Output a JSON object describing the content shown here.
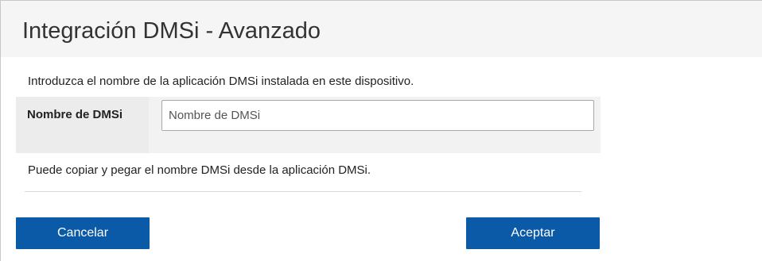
{
  "dialog": {
    "title": "Integración DMSi - Avanzado",
    "intro_text": "Introduzca el nombre de la aplicación DMSi instalada en este dispositivo.",
    "field": {
      "label": "Nombre de DMSi",
      "value": "",
      "placeholder": "Nombre de DMSi"
    },
    "help_text": "Puede copiar y pegar el nombre DMSi desde la aplicación DMSi.",
    "buttons": {
      "cancel_label": "Cancelar",
      "ok_label": "Aceptar"
    },
    "colors": {
      "button_bg": "#0a5aa8",
      "header_bg": "#f5f5f5",
      "row_bg": "#f2f2f2"
    }
  }
}
